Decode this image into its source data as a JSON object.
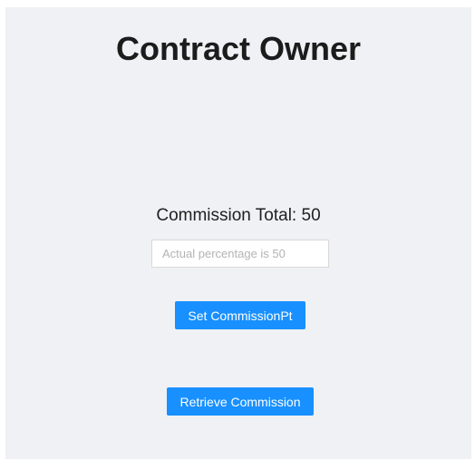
{
  "header": {
    "title": "Contract Owner"
  },
  "commission": {
    "label": "Commission Total:",
    "total": "50"
  },
  "percentage_input": {
    "value": "",
    "placeholder": "Actual percentage is 50"
  },
  "buttons": {
    "set_commission_label": "Set CommissionPt",
    "retrieve_commission_label": "Retrieve Commission"
  },
  "colors": {
    "panel_background": "#f0f1f5",
    "primary_button": "#1890ff",
    "button_text": "#ffffff",
    "title_text": "#1c1c1c"
  }
}
